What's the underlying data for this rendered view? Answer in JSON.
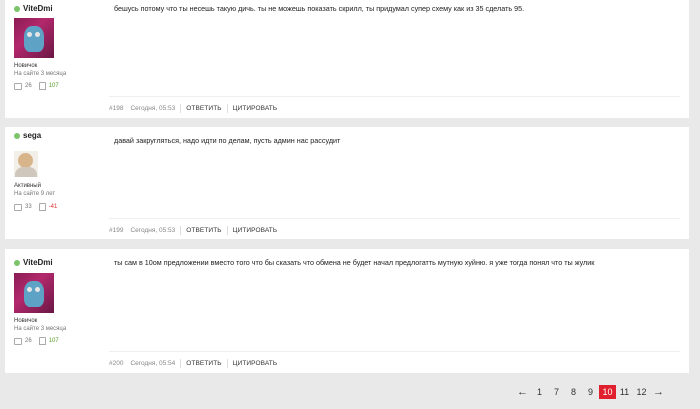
{
  "posts": [
    {
      "author": "ViteDmi",
      "rank": "Новичок",
      "since": "На сайте 3 месяца",
      "messages": "26",
      "rating": "107",
      "text": "бешусь потому что ты несешь такую дичь.  ты не можешь показать скрилл, ты придумал супер схему как из 35 сделать 95.",
      "number": "#198",
      "time": "Сегодня, 05:53",
      "reply_label": "ОТВЕТИТЬ",
      "quote_label": "ЦИТИРОВАТЬ"
    },
    {
      "author": "sega",
      "rank": "Активный",
      "since": "На сайте 9 лет",
      "messages": "33",
      "rating": "-41",
      "text": "давай закругляться, надо идти по делам, пусть админ нас рассудит",
      "number": "#199",
      "time": "Сегодня, 05:53",
      "reply_label": "ОТВЕТИТЬ",
      "quote_label": "ЦИТИРОВАТЬ"
    },
    {
      "author": "ViteDmi",
      "rank": "Новичок",
      "since": "На сайте 3 месяца",
      "messages": "26",
      "rating": "107",
      "text": "ты сам в 10ом предложении вместо того что бы сказать что обмена не будет начал предлогатть мутную хуйню. я уже тогда понял что ты жулик",
      "number": "#200",
      "time": "Сегодня, 05:54",
      "reply_label": "ОТВЕТИТЬ",
      "quote_label": "ЦИТИРОВАТЬ"
    }
  ],
  "pagination": {
    "prev": "←",
    "pages": [
      "1",
      "7",
      "8",
      "9",
      "10",
      "11",
      "12"
    ],
    "current": "10",
    "next": "→"
  },
  "colors": {
    "online": "#7cc36a",
    "active_page": "#e0202e",
    "positive": "#5a9e28",
    "negative": "#dd3333"
  }
}
